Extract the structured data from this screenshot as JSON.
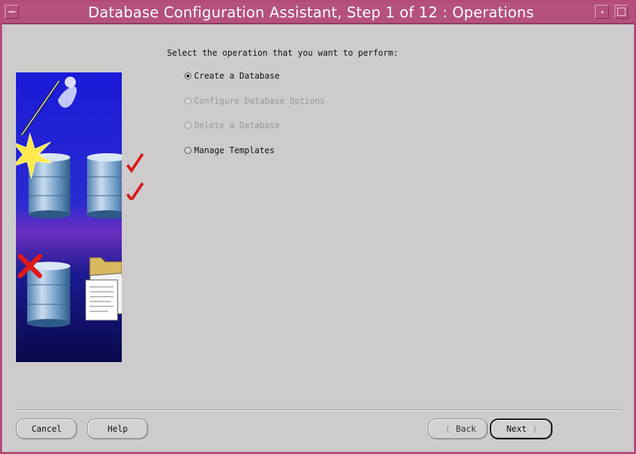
{
  "window": {
    "title": "Database Configuration Assistant, Step 1 of 12 : Operations"
  },
  "main": {
    "prompt": "Select the operation that you want to perform:",
    "options": [
      {
        "label": "Create a Database",
        "selected": true,
        "enabled": true
      },
      {
        "label": "Configure Database Options",
        "selected": false,
        "enabled": false
      },
      {
        "label": "Delete a Database",
        "selected": false,
        "enabled": false
      },
      {
        "label": "Manage Templates",
        "selected": false,
        "enabled": true
      }
    ]
  },
  "buttons": {
    "cancel": "Cancel",
    "help": "Help",
    "back": "Back",
    "next": "Next"
  },
  "icons": {
    "back_arrow": "chevron-left-icon",
    "next_arrow": "chevron-right-icon"
  },
  "colors": {
    "titlebar": "#b5517f",
    "window_bg": "#cecbcd",
    "disabled_text": "#9b989a"
  }
}
